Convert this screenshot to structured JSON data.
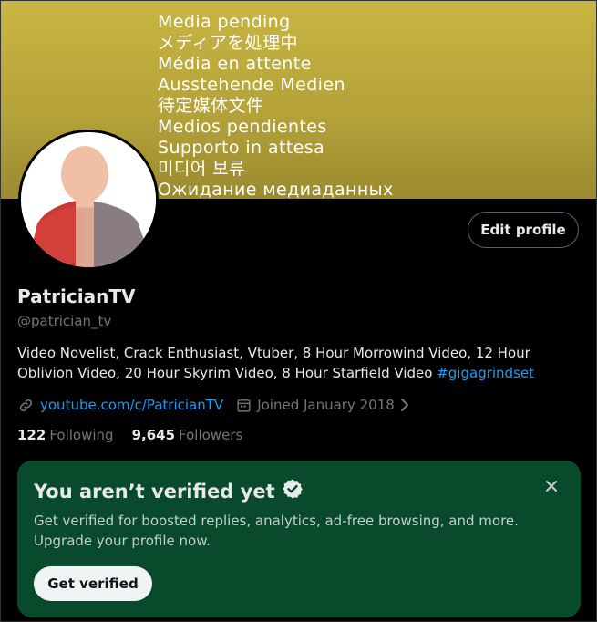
{
  "banner": {
    "pending_lines": [
      "Media pending",
      "メディアを処理中",
      "Média en attente",
      "Ausstehende Medien",
      "待定媒体文件",
      "Medios pendientes",
      "Supporto in attesa",
      "미디어 보류",
      "Ожидание медиаданных"
    ],
    "color": "#c8b541"
  },
  "profile": {
    "edit_label": "Edit profile",
    "name": "PatricianTV",
    "handle": "@patrician_tv",
    "bio_text": "Video Novelist, Crack Enthusiast, Vtuber, 8 Hour Morrowind Video, 12 Hour Oblivion Video, 20 Hour Skyrim Video, 8 Hour Starfield Video",
    "bio_hashtag": "#gigagrindset",
    "link_text": "youtube.com/c/PatricianTV",
    "joined_text": "Joined January 2018",
    "following_count": "122",
    "following_label": "Following",
    "followers_count": "9,645",
    "followers_label": "Followers",
    "icons": [
      "link-icon",
      "calendar-icon",
      "chevron-right-icon"
    ]
  },
  "verify_card": {
    "title": "You aren’t verified yet",
    "body": "Get verified for boosted replies, analytics, ad-free browsing, and more. Upgrade your profile now.",
    "button_label": "Get verified",
    "icons": [
      "verified-badge-icon",
      "close-icon"
    ],
    "background": "#0a4a2c"
  },
  "colors": {
    "accent": "#1d9bf0",
    "text": "#e7e9ea",
    "muted": "#71767b",
    "background": "#000000"
  }
}
